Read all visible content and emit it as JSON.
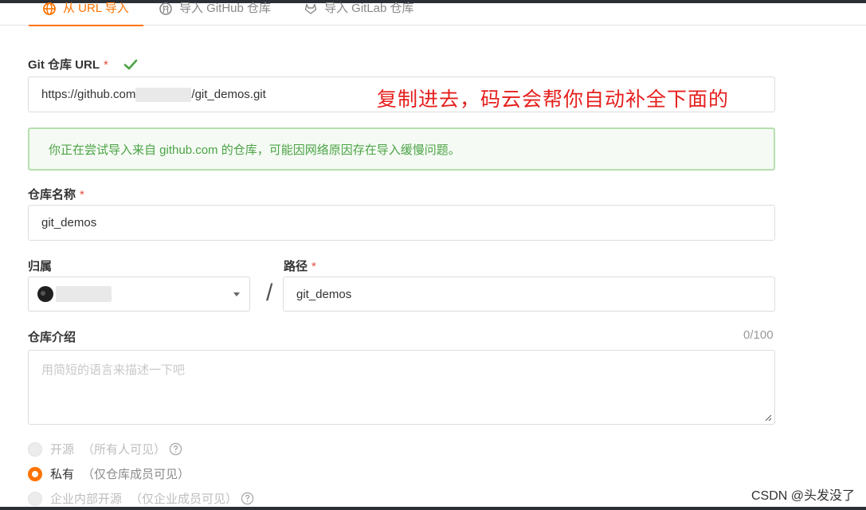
{
  "tabs": [
    {
      "label": "从 URL 导入",
      "icon": "globe-icon",
      "active": true
    },
    {
      "label": "导入 GitHub 仓库",
      "icon": "github-icon",
      "active": false
    },
    {
      "label": "导入 GitLab 仓库",
      "icon": "gitlab-icon",
      "active": false
    }
  ],
  "git_url": {
    "label": "Git 仓库 URL",
    "required_mark": "*",
    "value_prefix": "https://github.com",
    "value_suffix": "/git_demos.git",
    "valid_icon": "check-icon"
  },
  "annotation": "复制进去，码云会帮你自动补全下面的",
  "alert": "你正在尝试导入来自 github.com 的仓库，可能因网络原因存在导入缓慢问题。",
  "repo_name": {
    "label": "仓库名称",
    "required_mark": "*",
    "value": "git_demos"
  },
  "owner": {
    "label": "归属"
  },
  "path": {
    "label": "路径",
    "required_mark": "*",
    "separator": "/",
    "value": "git_demos"
  },
  "description": {
    "label": "仓库介绍",
    "counter": "0/100",
    "placeholder": "用简短的语言来描述一下吧"
  },
  "visibility": [
    {
      "label": "开源",
      "hint": "（所有人可见）",
      "state": "disabled",
      "help_icon": "help-circle-icon"
    },
    {
      "label": "私有",
      "hint": "（仅仓库成员可见）",
      "state": "checked"
    },
    {
      "label": "企业内部开源",
      "hint": "（仅企业成员可见）",
      "state": "disabled",
      "help_icon": "help-circle-icon"
    }
  ],
  "watermark": "CSDN @头发没了",
  "colors": {
    "accent": "#fe7300",
    "required": "#e74c3c",
    "success": "#4ca346",
    "annotation": "#e5201e"
  }
}
